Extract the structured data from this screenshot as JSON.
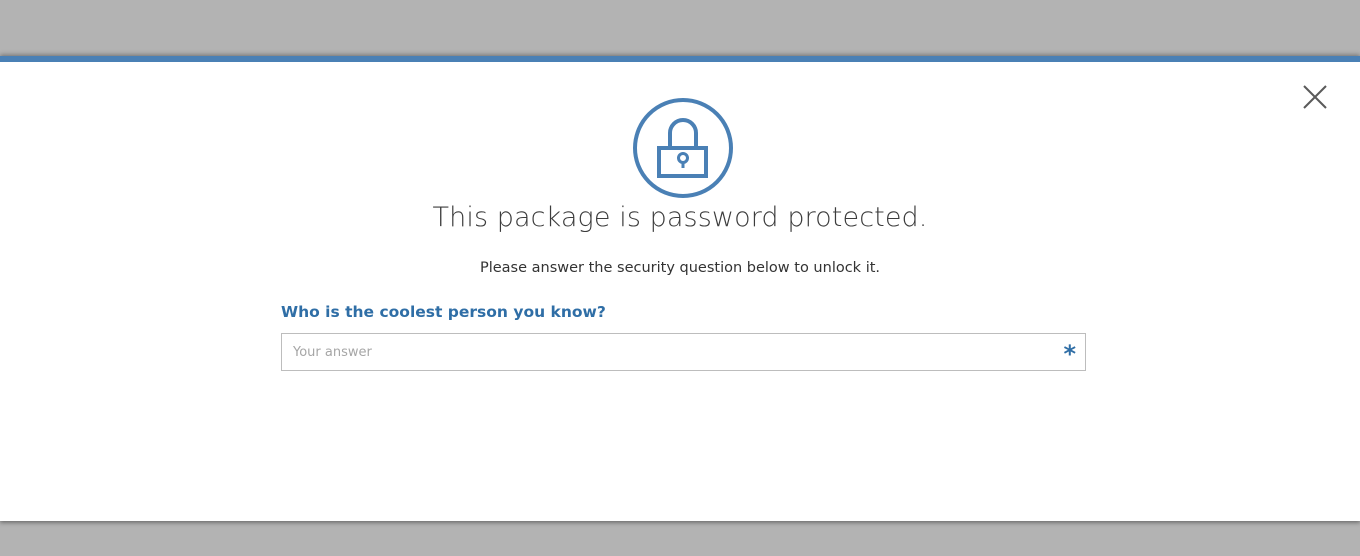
{
  "dialog": {
    "title": "This package is password protected.",
    "subtitle": "Please answer the security question below to unlock it.",
    "question": "Who is the coolest person you know?",
    "answer_placeholder": "Your answer",
    "answer_value": "",
    "required_marker": "*"
  },
  "icons": {
    "lock": "lock-icon",
    "close": "close-icon"
  },
  "colors": {
    "accent": "#4a80b5",
    "question_text": "#2f6ea6",
    "backdrop": "#b3b3b3"
  }
}
